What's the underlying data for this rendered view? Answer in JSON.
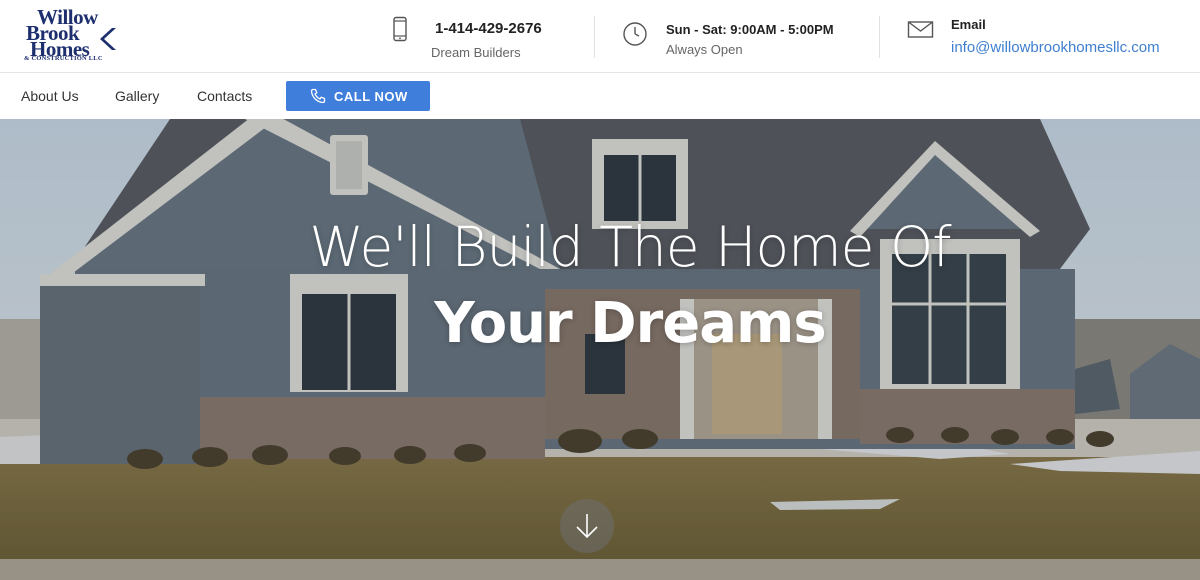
{
  "logo": {
    "line1": "Willow",
    "line2": "Brook",
    "line3": "Homes",
    "tagline": "& CONSTRUCTION LLC"
  },
  "contact": {
    "phone": "1-414-429-2676",
    "phone_sub": "Dream Builders",
    "hours": "Sun - Sat: 9:00AM - 5:00PM",
    "hours_sub": "Always Open",
    "email_label": "Email",
    "email": "info@willowbrookhomesllc.com"
  },
  "nav": {
    "about": "About Us",
    "gallery": "Gallery",
    "contacts": "Contacts",
    "call_now": "CALL NOW"
  },
  "hero": {
    "line1": "We'll Build The Home Of",
    "line2": "Your Dreams"
  },
  "icons": {
    "phone": "smartphone-icon",
    "clock": "clock-icon",
    "email": "envelope-icon",
    "call": "phone-handset-icon",
    "scroll": "arrow-down-icon"
  },
  "colors": {
    "brand_navy": "#1d2f6e",
    "accent_blue": "#3f7fdb",
    "link_blue": "#3f7fd0"
  }
}
